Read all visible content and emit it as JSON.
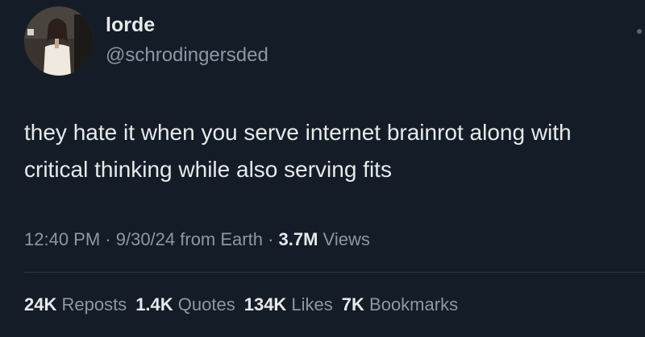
{
  "user": {
    "display_name": "lorde",
    "handle": "@schrodingersded",
    "avatar_icon": "profile-photo"
  },
  "tweet": {
    "text": "they hate it when you serve internet brainrot along with critical thinking while also serving fits"
  },
  "meta": {
    "time": "12:40 PM",
    "separator": " · ",
    "date": "9/30/24",
    "source": " from Earth",
    "views_count": "3.7M",
    "views_label": " Views"
  },
  "stats": {
    "reposts_count": "24K",
    "reposts_label": " Reposts",
    "quotes_count": "1.4K",
    "quotes_label": " Quotes",
    "likes_count": "134K",
    "likes_label": " Likes",
    "bookmarks_count": "7K",
    "bookmarks_label": " Bookmarks"
  },
  "colors": {
    "background": "#141c27",
    "primary_text": "#e7e9ea",
    "secondary_text": "#8b98a5"
  }
}
